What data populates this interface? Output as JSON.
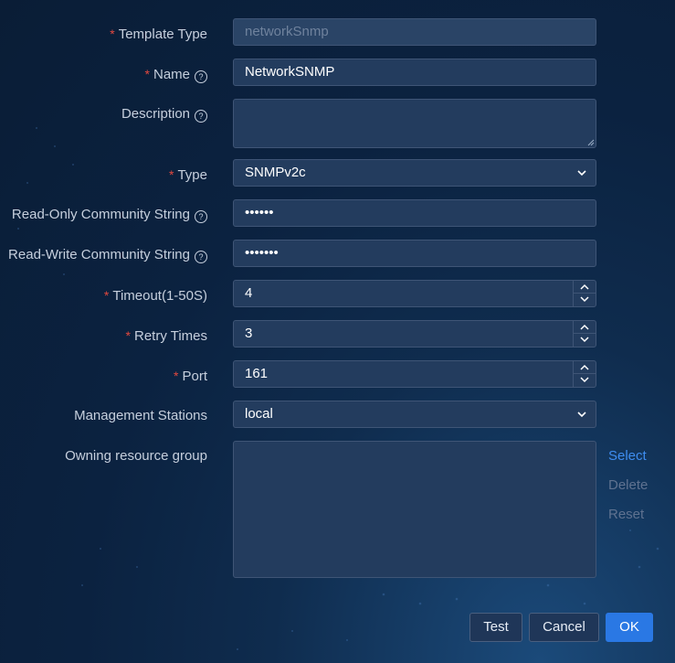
{
  "form": {
    "template_type": {
      "label": "Template Type",
      "value": "networkSnmp"
    },
    "name": {
      "label": "Name",
      "value": "NetworkSNMP"
    },
    "description": {
      "label": "Description",
      "value": ""
    },
    "type": {
      "label": "Type",
      "value": "SNMPv2c"
    },
    "read_only_community": {
      "label": "Read-Only Community String",
      "value": "••••••"
    },
    "read_write_community": {
      "label": "Read-Write Community String",
      "value": "•••••••"
    },
    "timeout": {
      "label": "Timeout(1-50S)",
      "value": "4"
    },
    "retry_times": {
      "label": "Retry Times",
      "value": "3"
    },
    "port": {
      "label": "Port",
      "value": "161"
    },
    "management_stations": {
      "label": "Management Stations",
      "value": "local"
    },
    "owning_resource_group": {
      "label": "Owning resource group",
      "value": ""
    }
  },
  "required_mark": "*",
  "help_mark": "?",
  "group_actions": {
    "select": "Select",
    "delete": "Delete",
    "reset": "Reset"
  },
  "footer": {
    "test": "Test",
    "cancel": "Cancel",
    "ok": "OK"
  },
  "colors": {
    "required": "#e2483f",
    "link": "#3e8df0",
    "primary": "#2a78e4"
  }
}
